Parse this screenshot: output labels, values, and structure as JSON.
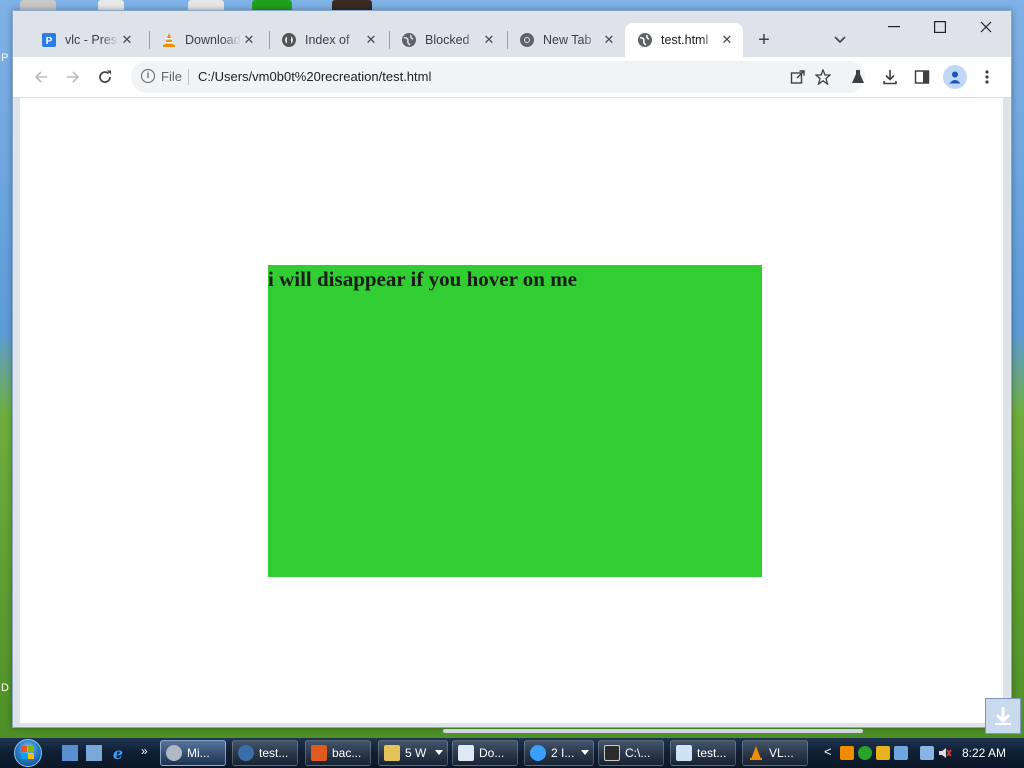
{
  "browser": {
    "tabs": [
      {
        "title": "vlc - Pres",
        "icon": "presentation-icon"
      },
      {
        "title": "Download",
        "icon": "vlc-cone-icon"
      },
      {
        "title": "Index of",
        "icon": "puzzle-icon"
      },
      {
        "title": "Blocked",
        "icon": "globe-icon"
      },
      {
        "title": "New Tab",
        "icon": "chrome-icon"
      },
      {
        "title": "test.html",
        "icon": "globe-icon",
        "active": true
      }
    ],
    "new_tab_symbol": "+",
    "address": {
      "scheme_label": "File",
      "url": "C:/Users/vm0b0t%20recreation/test.html"
    }
  },
  "page": {
    "heading": "i will disappear if you hover on me",
    "box_color": "#32cd32"
  },
  "taskbar": {
    "tasks": [
      {
        "label": "Mi...",
        "icon": "gear-icon",
        "active": true
      },
      {
        "label": "test...",
        "icon": "chrome-icon"
      },
      {
        "label": "bac...",
        "icon": "brave-icon"
      },
      {
        "label": "5 W",
        "icon": "folder-icon",
        "group": true
      },
      {
        "label": "Do...",
        "icon": "document-icon"
      },
      {
        "label": "2 I...",
        "icon": "ie-icon",
        "group": true
      },
      {
        "label": "C:\\...",
        "icon": "7zip-icon"
      },
      {
        "label": "test...",
        "icon": "notepad-icon"
      },
      {
        "label": "VL...",
        "icon": "vlc-cone-icon"
      }
    ],
    "clock": "8:22 AM",
    "chevron": "»",
    "tray_expand": "<"
  }
}
